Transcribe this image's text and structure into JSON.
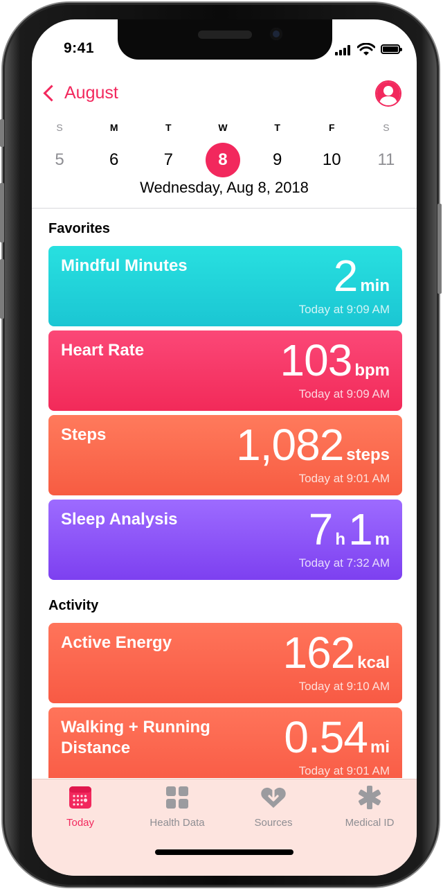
{
  "status": {
    "time": "9:41"
  },
  "nav": {
    "back_label": "August"
  },
  "week": {
    "days": [
      {
        "letter": "S",
        "date": "5",
        "dim": true
      },
      {
        "letter": "M",
        "date": "6",
        "dim": false
      },
      {
        "letter": "T",
        "date": "7",
        "dim": false
      },
      {
        "letter": "W",
        "date": "8",
        "dim": false,
        "selected": true
      },
      {
        "letter": "T",
        "date": "9",
        "dim": false
      },
      {
        "letter": "F",
        "date": "10",
        "dim": false
      },
      {
        "letter": "S",
        "date": "11",
        "dim": true
      }
    ],
    "date_label": "Wednesday, Aug 8, 2018"
  },
  "favorites": {
    "title": "Favorites",
    "cards": [
      {
        "title": "Mindful Minutes",
        "value": "2",
        "unit": "min",
        "time": "Today at 9:09 AM",
        "color": "#1bc6d3"
      },
      {
        "title": "Heart Rate",
        "value": "103",
        "unit": "bpm",
        "time": "Today at 9:09 AM",
        "color": "#f22a59"
      },
      {
        "title": "Steps",
        "value": "1,082",
        "unit": "steps",
        "time": "Today at 9:01 AM",
        "color": "#f75c42"
      },
      {
        "title": "Sleep Analysis",
        "value_h": "7",
        "unit_h": "h",
        "value_m": "1",
        "unit_m": "m",
        "time": "Today at 7:32 AM",
        "color": "#7d40f0"
      }
    ]
  },
  "activity": {
    "title": "Activity",
    "cards": [
      {
        "title": "Active Energy",
        "value": "162",
        "unit": "kcal",
        "time": "Today at 9:10 AM",
        "color": "#f85a44"
      },
      {
        "title": "Walking + Running Distance",
        "value": "0.54",
        "unit": "mi",
        "time": "Today at 9:01 AM",
        "color": "#f85a44"
      }
    ]
  },
  "tabs": [
    {
      "label": "Today",
      "icon": "calendar-icon",
      "active": true
    },
    {
      "label": "Health Data",
      "icon": "grid-icon",
      "active": false
    },
    {
      "label": "Sources",
      "icon": "heart-download-icon",
      "active": false
    },
    {
      "label": "Medical ID",
      "icon": "asterisk-icon",
      "active": false
    }
  ],
  "colors": {
    "accent": "#f2285d",
    "inactive": "#8e8e93",
    "tabbar_bg": "#fde4df"
  }
}
